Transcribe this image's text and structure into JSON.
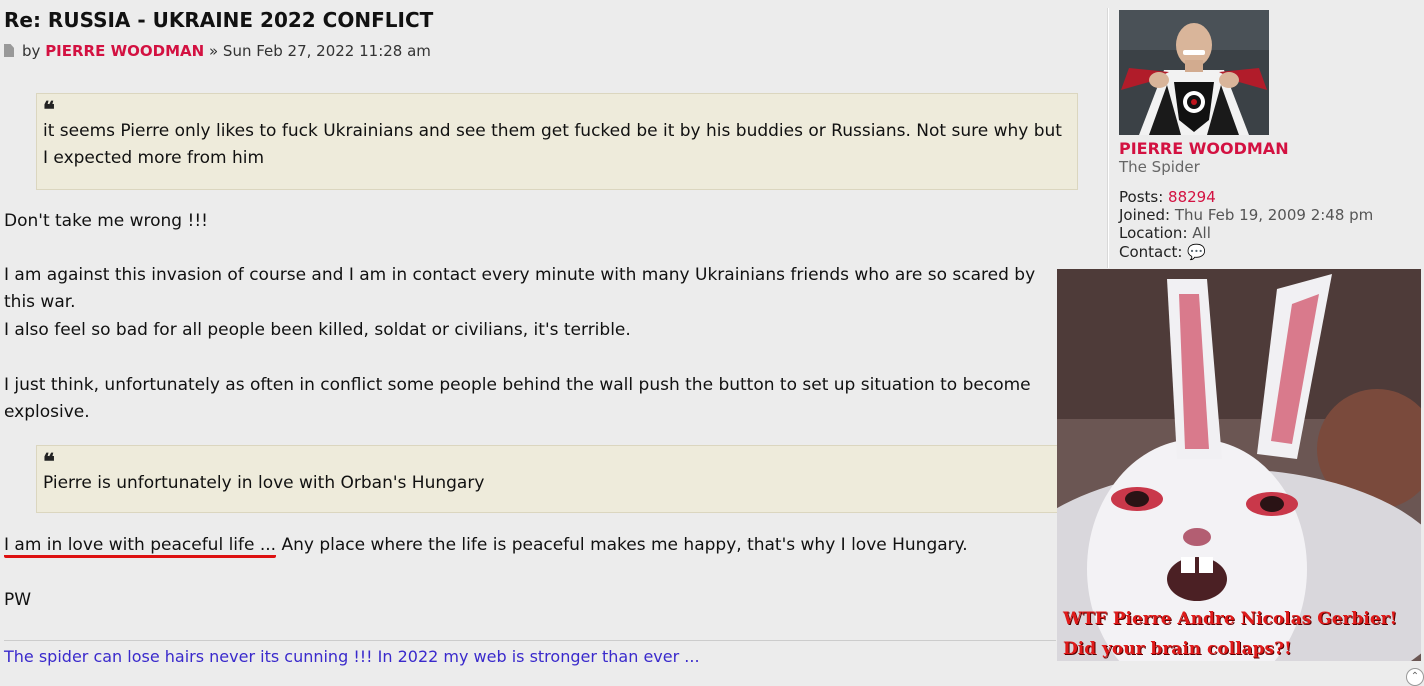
{
  "post": {
    "title": "Re: RUSSIA - UKRAINE 2022 CONFLICT",
    "by_label": "by",
    "author": "PIERRE WOODMAN",
    "separator": "»",
    "date": "Sun Feb 27, 2022 11:28 am",
    "quote1": "it seems Pierre only likes to fuck Ukrainians and see them get fucked be it by his buddies or Russians. Not sure why but I expected more from him",
    "para1": "Don't take me wrong !!!",
    "para2": "I am against this invasion of course and I am in contact every minute with many Ukrainians friends who are so scared by this war.",
    "para3": "I also feel so bad for all people been killed, soldat or civilians, it's terrible.",
    "para4": "I just think, unfortunately as often in conflict some people behind the wall push the button to set up situation to become explosive.",
    "quote2": "Pierre is unfortunately in love with Orban's Hungary",
    "para5_underlined": "I am in love with peaceful life ...",
    "para5_rest": " Any place where the life is peaceful makes me happy, that's why I love Hungary.",
    "para6": "PW",
    "signature": "The spider can lose hairs never its cunning !!! In 2022 my web is stronger than ever ...",
    "quote_mark": "❝"
  },
  "profile": {
    "name": "PIERRE WOODMAN",
    "rank": "The Spider",
    "posts_label": "Posts:",
    "posts_value": "88294",
    "joined_label": "Joined:",
    "joined_value": "Thu Feb 19, 2009 2:48 pm",
    "location_label": "Location:",
    "location_value": "All",
    "contact_label": "Contact:",
    "contact_icon": "💬"
  },
  "meme": {
    "caption_line1": "WTF Pierre Andre Nicolas Gerbier!",
    "caption_line2": "Did your brain collaps?!"
  },
  "colors": {
    "author": "#d31141",
    "signature": "#3a2acc",
    "quote_bg": "#eeebdb"
  }
}
